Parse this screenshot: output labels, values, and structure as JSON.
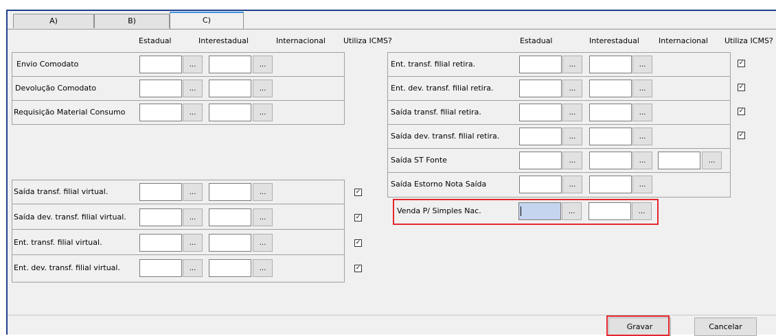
{
  "tabs": [
    {
      "label": "A)"
    },
    {
      "label": "B)"
    },
    {
      "label": "C)"
    }
  ],
  "headers": {
    "left": {
      "estadual": "Estadual",
      "interestadual": "Interestadual",
      "internacional": "Internacional",
      "utiliza": "Utiliza ICMS?"
    },
    "right": {
      "estadual": "Estadual",
      "interestadual": "Interestadual",
      "internacional": "Internacional",
      "utiliza": "Utiliza ICMS?"
    }
  },
  "browse_label": "...",
  "check_mark": "✓",
  "left_top_rows": [
    {
      "label": "Envio Comodato"
    },
    {
      "label": "Devolução Comodato"
    },
    {
      "label": "Requisição Material Consumo"
    }
  ],
  "left_bottom_rows": [
    {
      "label": "Saída transf. filial virtual.",
      "checked": true
    },
    {
      "label": "Saída dev. transf. filial virtual.",
      "checked": true
    },
    {
      "label": "Ent. transf. filial virtual.",
      "checked": true
    },
    {
      "label": "Ent. dev. transf. filial virtual.",
      "checked": true
    }
  ],
  "right_rows": [
    {
      "label": "Ent. transf. filial retira.",
      "checked": true
    },
    {
      "label": "Ent. dev. transf. filial retira.",
      "checked": true
    },
    {
      "label": "Saída transf. filial retira.",
      "checked": true
    },
    {
      "label": "Saída dev. transf. filial retira.",
      "checked": true
    },
    {
      "label": "Saída ST Fonte",
      "checked": false
    },
    {
      "label": "Saída Estorno Nota Saída",
      "checked": false
    },
    {
      "label": "Venda P/ Simples Nac.",
      "checked": false
    }
  ],
  "buttons": {
    "gravar": "Gravar",
    "cancelar": "Cancelar"
  },
  "colors": {
    "highlight": "#e3262c",
    "tab_accent": "#3b8fe0",
    "window_border": "#1f3f8a"
  }
}
